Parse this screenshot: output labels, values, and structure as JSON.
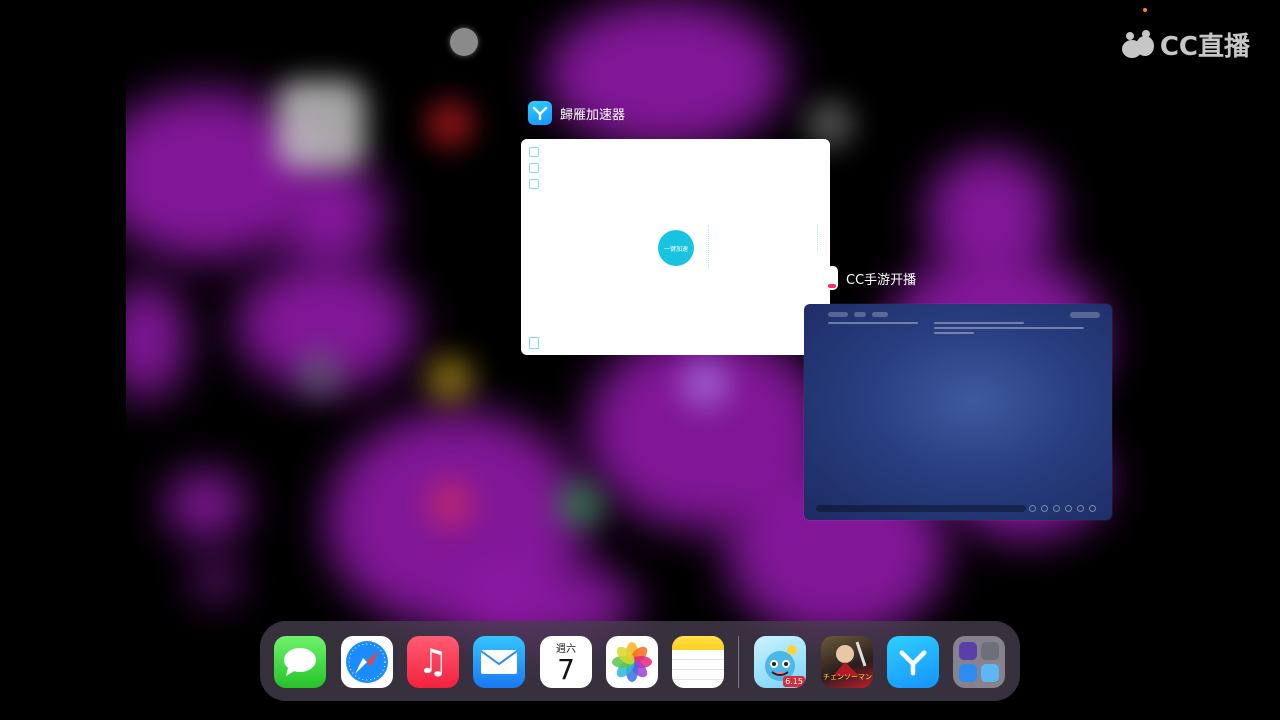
{
  "watermark": {
    "brand": "CC直播"
  },
  "switcher": {
    "cards": [
      {
        "app_name": "歸雁加速器",
        "icon": "accelerator-icon",
        "preview_badge": "一键加速"
      },
      {
        "app_name": "CC手游开播",
        "icon": "cc-live-icon"
      }
    ]
  },
  "dock": {
    "apps": [
      {
        "name": "Messages",
        "icon": "messages-icon"
      },
      {
        "name": "Safari",
        "icon": "compass-icon"
      },
      {
        "name": "Music",
        "icon": "music-note-icon"
      },
      {
        "name": "Mail",
        "icon": "envelope-icon"
      },
      {
        "name": "Calendar",
        "icon": "calendar-icon",
        "weekday": "週六",
        "day": "7"
      },
      {
        "name": "Photos",
        "icon": "flower-icon"
      },
      {
        "name": "Notes",
        "icon": "notes-icon"
      }
    ],
    "recent_apps": [
      {
        "name": "Game",
        "icon": "monster-icon",
        "badge": "6.15"
      },
      {
        "name": "Game",
        "icon": "warrior-icon",
        "label": "チェンソーマン"
      },
      {
        "name": "歸雁加速器",
        "icon": "accelerator-icon"
      },
      {
        "name": "App Library",
        "icon": "folder-icon"
      }
    ]
  },
  "colors": {
    "accent": "#1aa5ff",
    "wallpaper_glow": "#8f1aa8",
    "dock_bg": "#463e4e"
  }
}
